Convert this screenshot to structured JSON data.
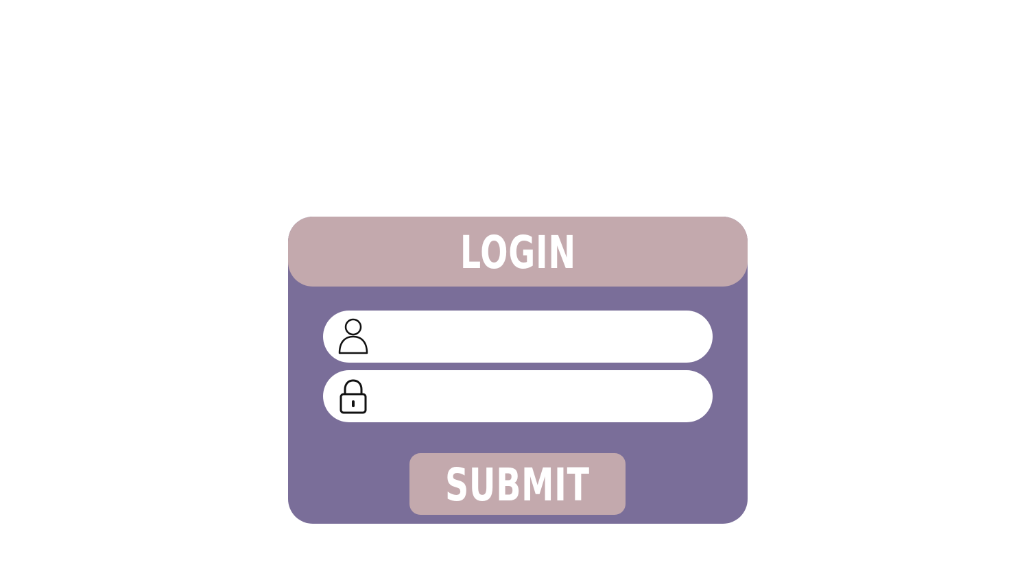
{
  "login_card": {
    "title": "LOGIN",
    "username_field": {
      "value": "",
      "placeholder": "",
      "icon": "user-icon"
    },
    "password_field": {
      "value": "",
      "placeholder": "",
      "icon": "lock-icon"
    },
    "submit_label": "SUBMIT"
  },
  "colors": {
    "card_background": "#7a6e99",
    "header_background": "#c3a9ad",
    "button_background": "#c3a9ad",
    "field_background": "#ffffff",
    "text_color": "#ffffff"
  }
}
